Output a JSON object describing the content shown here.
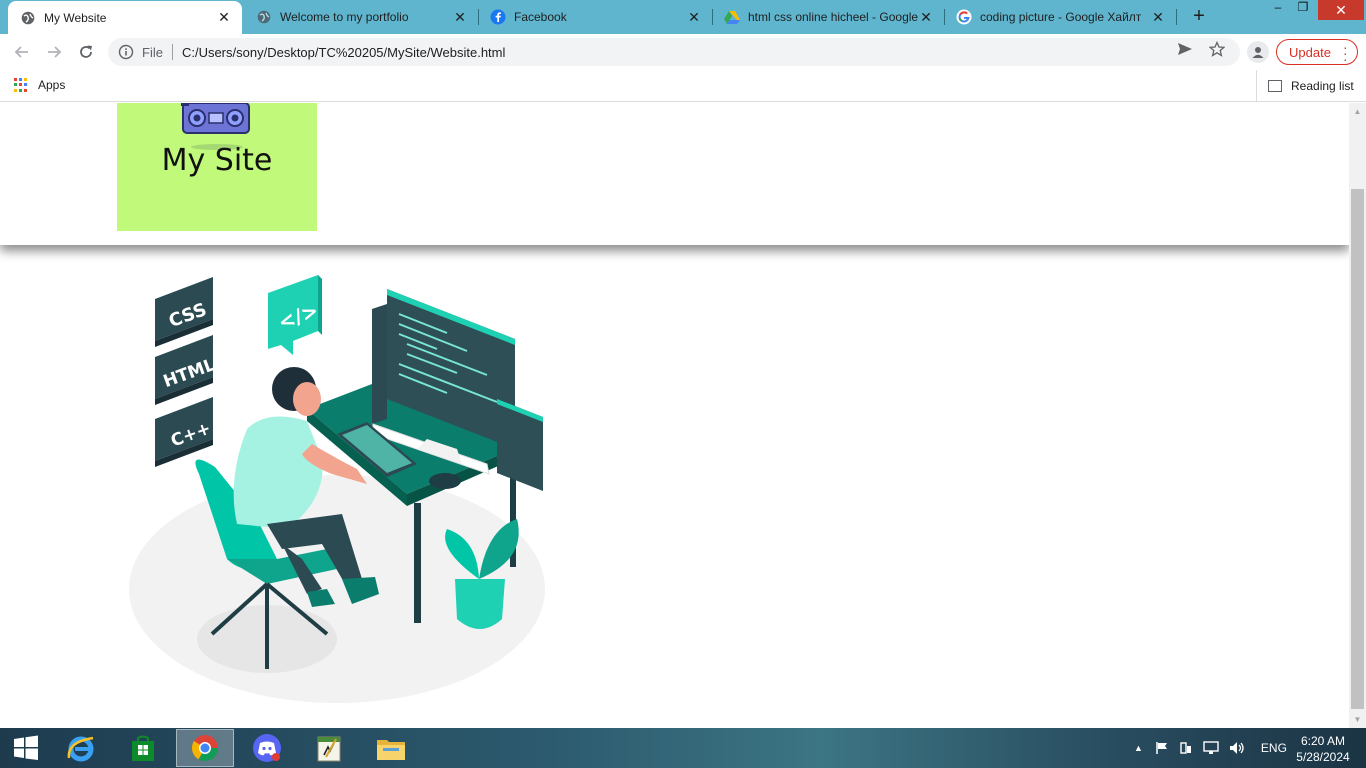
{
  "tabs": [
    {
      "title": "My Website",
      "favicon": "globe-icon",
      "active": true
    },
    {
      "title": "Welcome to my portfolio",
      "favicon": "globe-icon",
      "active": false
    },
    {
      "title": "Facebook",
      "favicon": "facebook-icon",
      "active": false
    },
    {
      "title": "html css online hicheel - Google",
      "favicon": "google-drive-icon",
      "active": false
    },
    {
      "title": "coding picture - Google Хайлт",
      "favicon": "google-icon",
      "active": false
    }
  ],
  "toolbar": {
    "scheme": "File",
    "url": "C:/Users/sony/Desktop/TC%20205/MySite/Website.html",
    "update_label": "Update"
  },
  "bookmarks": {
    "apps_label": "Apps",
    "reading_list_label": "Reading list"
  },
  "page": {
    "logo_text": "My Site",
    "hero_labels": [
      "CSS",
      "HTML",
      "C++",
      "</>"
    ]
  },
  "taskbar": {
    "apps": [
      "start-icon",
      "internet-explorer-icon",
      "store-icon",
      "chrome-icon",
      "discord-icon",
      "notepad-icon",
      "file-explorer-icon"
    ],
    "language": "ENG",
    "time": "6:20 AM",
    "date": "5/28/2024"
  },
  "colors": {
    "tab_strip": "#5fb5cd",
    "logo_bg": "#c1f97a",
    "accent_teal": "#00c6a7",
    "dark_teal": "#0b6b5c",
    "update_red": "#d93025"
  }
}
